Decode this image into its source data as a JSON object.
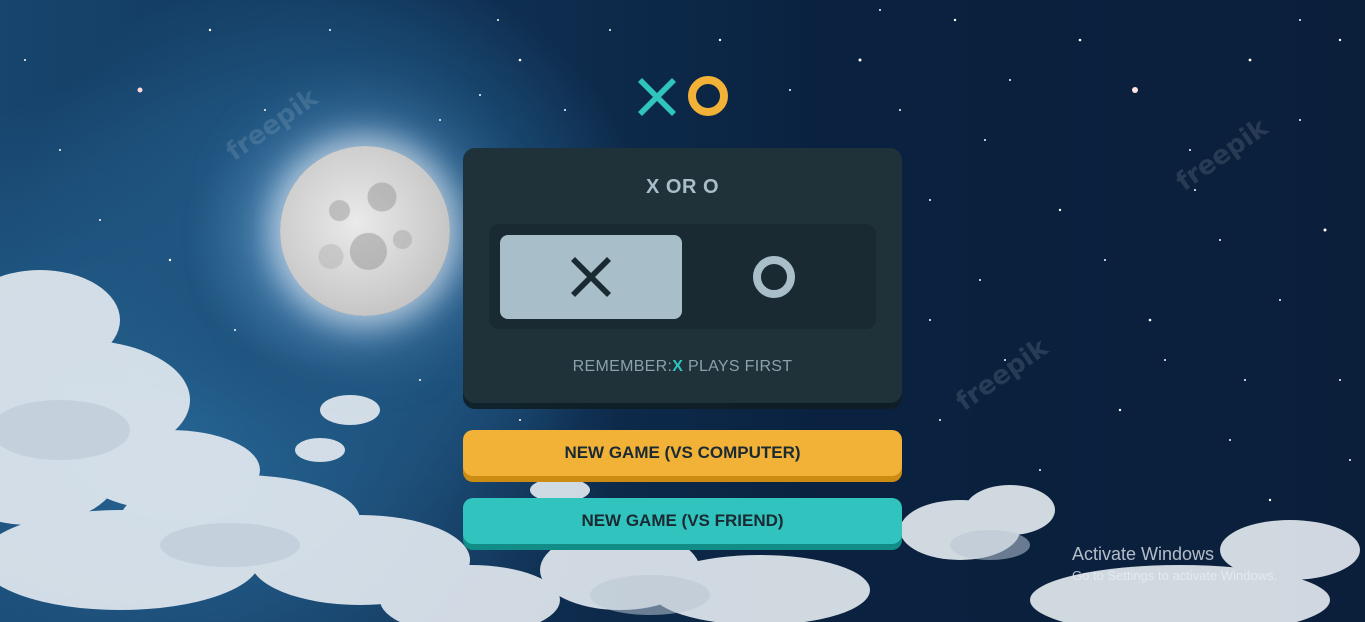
{
  "logo": {
    "x_icon": "x-mark-icon",
    "o_icon": "o-mark-icon"
  },
  "panel": {
    "title": "X OR O",
    "options": [
      {
        "mark": "X",
        "icon": "x-mark-icon",
        "selected": true
      },
      {
        "mark": "O",
        "icon": "o-mark-icon",
        "selected": false
      }
    ],
    "remember_prefix": "REMEMBER:",
    "remember_mark": "X",
    "remember_suffix": " PLAYS FIRST"
  },
  "buttons": {
    "vs_computer": "NEW GAME (VS COMPUTER)",
    "vs_friend": "NEW GAME (VS FRIEND)"
  },
  "watermark": {
    "activate_title": "Activate Windows",
    "activate_subtitle": "Go to Settings to activate Windows."
  },
  "colors": {
    "x_accent": "#31c3bd",
    "o_accent": "#f2b137",
    "panel_bg": "#1f3139",
    "option_selected_bg": "#a8bfc9",
    "text_dark": "#1a2a33"
  }
}
